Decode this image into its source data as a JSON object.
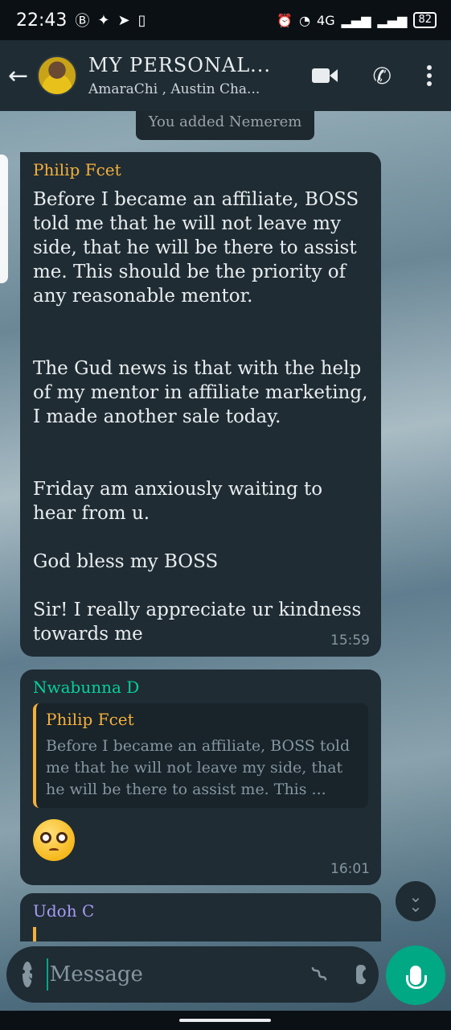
{
  "status_bar": {
    "time": "22:43",
    "network": "4G",
    "battery": "82"
  },
  "header": {
    "title": "MY PERSONAL...",
    "subtitle": "AmaraChi , Austin Cha...",
    "icons": [
      "back-arrow-icon",
      "video-call-icon",
      "phone-icon",
      "more-options-icon"
    ]
  },
  "system_message": "You added Nemerem",
  "messages": [
    {
      "sender": "Philip Fcet",
      "sender_color": "#f6b03a",
      "text": "Before I became an affiliate, BOSS told me that he will not leave my side, that he will be there to assist me. This should be the priority of any reasonable mentor.\n\n\nThe Gud news is that with the help of my mentor in affiliate marketing, I made another sale today.\n\n\nFriday am anxiously waiting to hear from u.\n\nGod bless my BOSS\n\nSir! I really appreciate ur kindness towards me",
      "time": "15:59"
    },
    {
      "sender": "Nwabunna D",
      "sender_color": "#06cf9c",
      "quote_author": "Philip Fcet",
      "quote_text": "Before I became an affiliate, BOSS told me that he will not leave my side, that he will be there to assist me. This ...",
      "emoji": "pleading-face-emoji",
      "time": "16:01"
    },
    {
      "sender": "Udoh C",
      "sender_color": "#a79cf5"
    }
  ],
  "composer": {
    "placeholder": "Message"
  },
  "colors": {
    "accent": "#00a884",
    "bubble": "#1f2c34",
    "header": "#1f2c34"
  }
}
